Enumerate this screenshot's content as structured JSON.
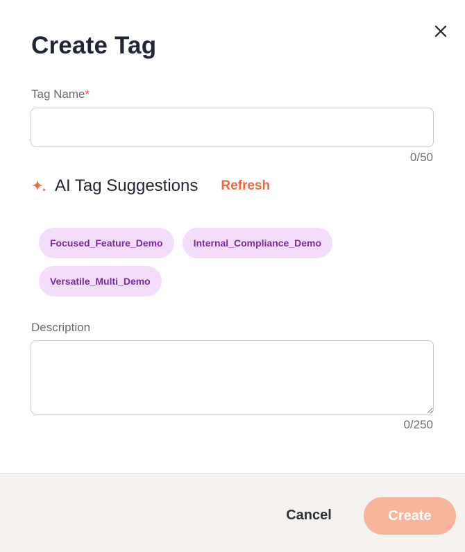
{
  "dialog": {
    "title": "Create Tag",
    "close_icon": "close-icon"
  },
  "tag_name": {
    "label": "Tag Name",
    "required_mark": "*",
    "value": "",
    "placeholder": "",
    "counter": "0/50"
  },
  "ai_suggestions": {
    "icon": "sparkle-icon",
    "title": "AI Tag Suggestions",
    "refresh_label": "Refresh",
    "chips": [
      "Focused_Feature_Demo",
      "Internal_Compliance_Demo",
      "Versatile_Multi_Demo"
    ]
  },
  "description": {
    "label": "Description",
    "value": "",
    "placeholder": "",
    "counter": "0/250"
  },
  "footer": {
    "cancel_label": "Cancel",
    "create_label": "Create",
    "create_disabled": true
  },
  "colors": {
    "accent": "#f26a3b",
    "create_disabled_bg": "#f9b59c",
    "chip_bg": "#f3ddfb",
    "chip_text": "#7c2a9e",
    "footer_bg": "#f6f2f0",
    "required": "#e0503d"
  }
}
